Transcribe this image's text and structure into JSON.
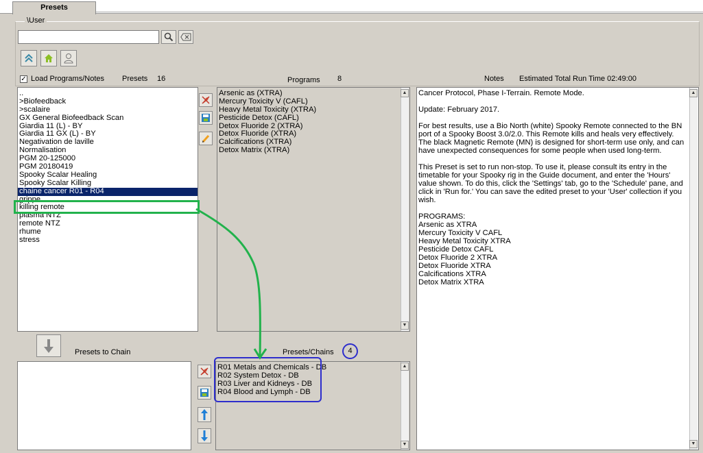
{
  "tabs": {
    "active_label": "Presets"
  },
  "group_label": "\\User",
  "search": {
    "value": "",
    "placeholder": ""
  },
  "load_programs": {
    "label": "Load Programs/Notes",
    "checked": true
  },
  "presets": {
    "header": "Presets",
    "count": "16",
    "items": [
      "..",
      ">Biofeedback",
      ">scalaire",
      "GX General Biofeedback Scan",
      "Giardia 11 (L) - BY",
      "Giardia 11 GX (L) - BY",
      "Negativation de laville",
      "Normalisation",
      "PGM 20-125000",
      "PGM 20180419",
      "Spooky Scalar Healing",
      "Spooky Scalar Killing",
      "chaine cancer R01 - R04",
      "grippe",
      "killing remote",
      "plasma NTZ",
      "remote NTZ",
      "rhume",
      "stress"
    ],
    "selected_index": 12
  },
  "programs": {
    "header": "Programs",
    "count": "8",
    "items": [
      "Arsenic as (XTRA)",
      "Mercury Toxicity V (CAFL)",
      "Heavy Metal Toxicity (XTRA)",
      "Pesticide Detox (CAFL)",
      "Detox Fluoride 2 (XTRA)",
      "Detox Fluoride (XTRA)",
      "Calcifications (XTRA)",
      "Detox Matrix (XTRA)"
    ]
  },
  "notes": {
    "header": "Notes",
    "run_time_label": "Estimated Total Run Time 02:49:00",
    "paragraphs": [
      "Cancer Protocol, Phase I-Terrain. Remote Mode.",
      "Update: February 2017.",
      "For best results, use a Bio North (white) Spooky Remote connected to the BN port of a Spooky Boost 3.0/2.0. This Remote kills and heals very effectively. The black Magnetic Remote (MN) is designed for short-term use only, and can have unexpected consequences for some people when used long-term.",
      "This Preset is set to run non-stop. To use it, please consult its entry in the timetable for your Spooky rig in the Guide document, and enter the 'Hours' value shown. To do this, click the 'Settings' tab, go to the 'Schedule' pane, and click in 'Run for.' You can save the edited preset to your 'User' collection if you wish.",
      "PROGRAMS:\nArsenic as XTRA\nMercury Toxicity V CAFL\nHeavy Metal Toxicity XTRA\nPesticide Detox CAFL\nDetox Fluoride 2 XTRA\nDetox Fluoride XTRA\nCalcifications XTRA\nDetox Matrix XTRA"
    ]
  },
  "presets_to_chain": {
    "label": "Presets to Chain"
  },
  "chains": {
    "header": "Presets/Chains",
    "count": "4",
    "items": [
      "R01 Metals and Chemicals - DB",
      "R02 System Detox - DB",
      "R03 Liver and Kidneys - DB",
      "R04 Blood and Lymph - DB"
    ]
  },
  "colors": {
    "selection": "#0a246a",
    "annotation_green": "#22b24c",
    "annotation_blue": "#2d2dcc",
    "panel_bg": "#d4d0c8"
  },
  "icons": [
    "search-icon",
    "clear-icon",
    "up-arrow-icon",
    "home-icon",
    "user-icon",
    "delete-icon",
    "save-icon",
    "edit-icon",
    "down-arrow-icon",
    "arrow-up-icon",
    "arrow-down-icon"
  ]
}
